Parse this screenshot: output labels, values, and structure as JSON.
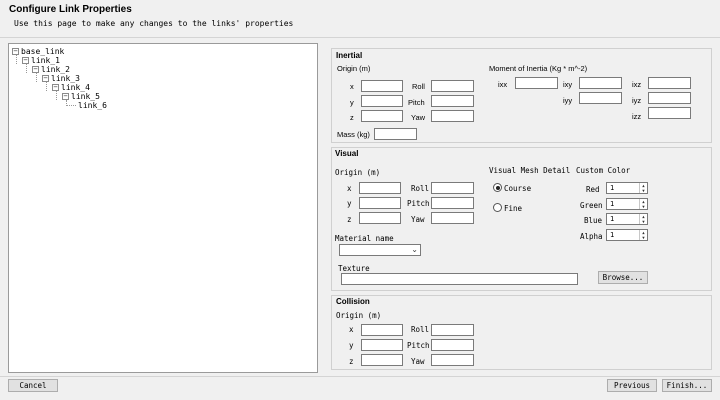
{
  "header": {
    "title": "Configure Link Properties",
    "subtitle": "Use this page to make any changes to the links' properties"
  },
  "tree": {
    "nodes": [
      {
        "label": "base_link",
        "expanded": true
      },
      {
        "label": "link_1",
        "expanded": true
      },
      {
        "label": "link_2",
        "expanded": true
      },
      {
        "label": "link_3",
        "expanded": true
      },
      {
        "label": "link_4",
        "expanded": true
      },
      {
        "label": "link_5",
        "expanded": true
      },
      {
        "label": "link_6",
        "expanded": false
      }
    ],
    "collapse_glyph": "−"
  },
  "inertial": {
    "title": "Inertial",
    "origin_label": "Origin (m)",
    "x": "x",
    "y": "y",
    "z": "z",
    "roll": "Roll",
    "pitch": "Pitch",
    "yaw": "Yaw",
    "moment_label": "Moment of Inertia (Kg * m^-2)",
    "ixx": "ixx",
    "ixy": "ixy",
    "ixz": "ixz",
    "iyy": "iyy",
    "iyz": "iyz",
    "izz": "izz",
    "mass_label": "Mass (kg)"
  },
  "visual": {
    "title": "Visual",
    "origin_label": "Origin (m)",
    "x": "x",
    "y": "y",
    "z": "z",
    "roll": "Roll",
    "pitch": "Pitch",
    "yaw": "Yaw",
    "mesh_detail_label": "Visual Mesh Detail",
    "course_label": "Course",
    "fine_label": "Fine",
    "course_selected": true,
    "custom_color_label": "Custom Color",
    "red_label": "Red",
    "green_label": "Green",
    "blue_label": "Blue",
    "alpha_label": "Alpha",
    "red": "1",
    "green": "1",
    "blue": "1",
    "alpha": "1",
    "material_label": "Material name",
    "material_value": "",
    "texture_label": "Texture",
    "browse_label": "Browse..."
  },
  "collision": {
    "title": "Collision",
    "origin_label": "Origin (m)",
    "x": "x",
    "y": "y",
    "z": "z",
    "roll": "Roll",
    "pitch": "Pitch",
    "yaw": "Yaw"
  },
  "footer": {
    "cancel": "Cancel",
    "previous": "Previous",
    "finish": "Finish..."
  },
  "icons": {
    "spin_up": "up-arrow-icon",
    "spin_down": "down-arrow-icon",
    "chevron": "chevron-down-icon"
  }
}
